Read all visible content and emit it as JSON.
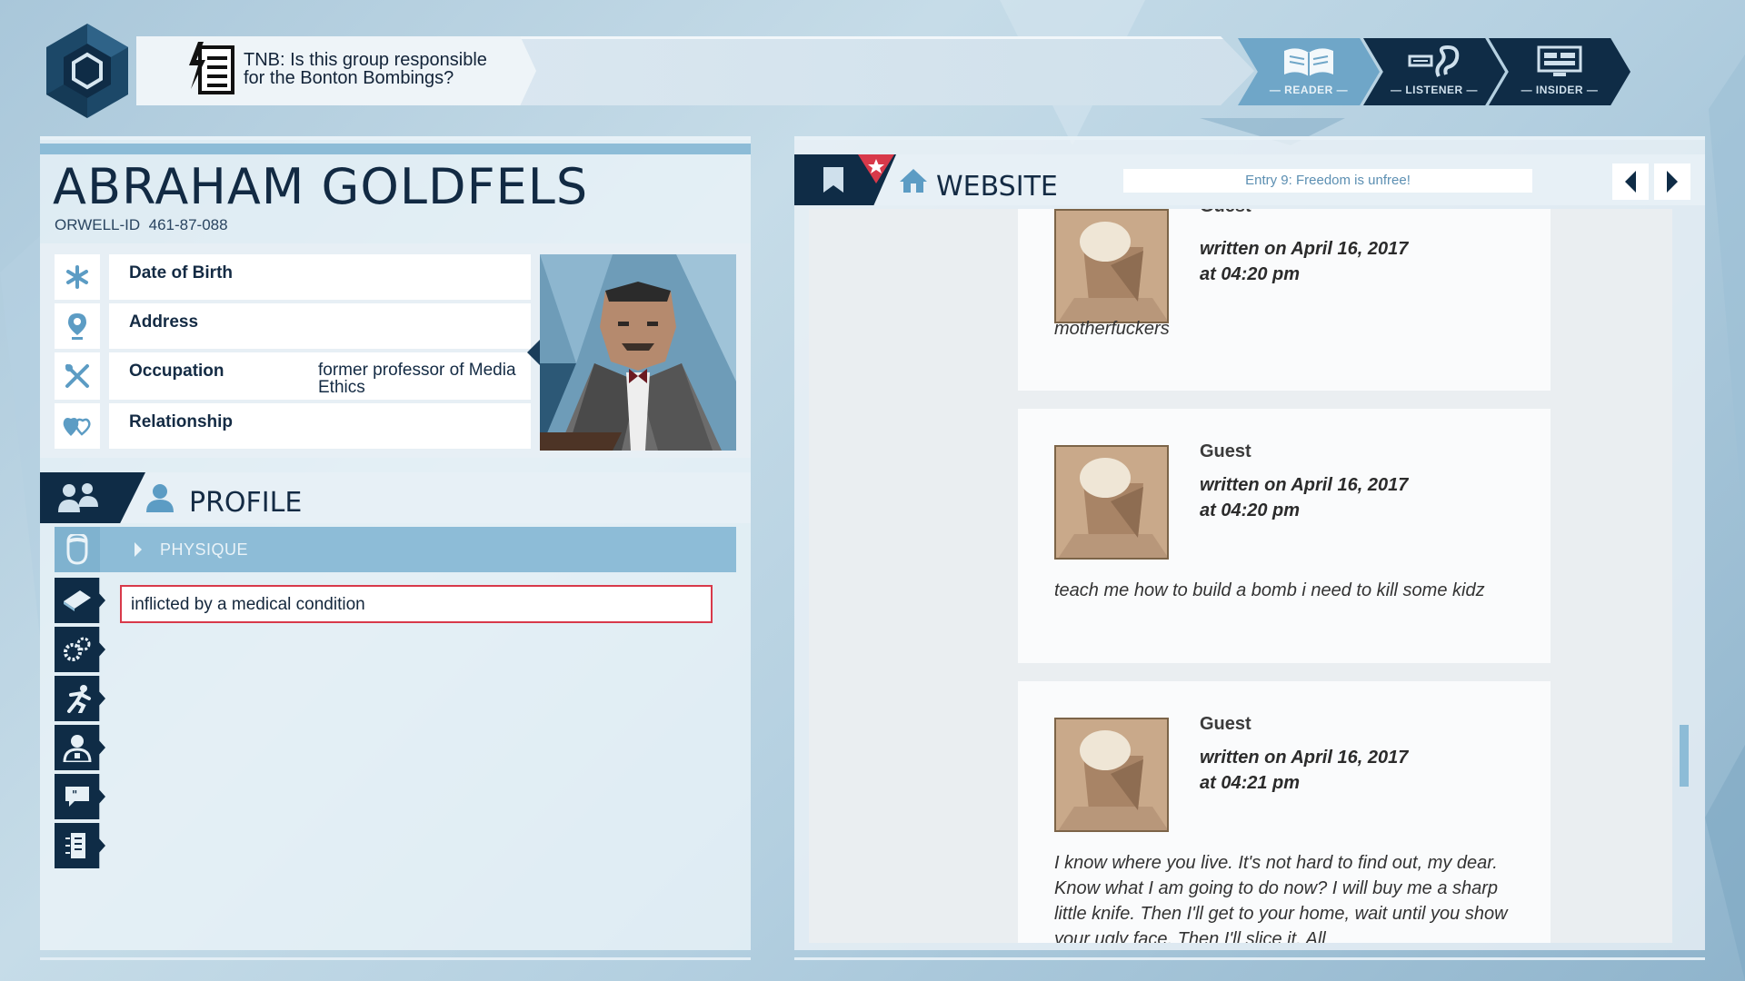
{
  "topbar": {
    "question_line1": "TNB: Is this group responsible",
    "question_line2": "for the Bonton Bombings?",
    "modes": [
      {
        "label": "— READER —",
        "active": true,
        "icon": "book-icon"
      },
      {
        "label": "— LISTENER —",
        "active": false,
        "icon": "ear-icon"
      },
      {
        "label": "— INSIDER —",
        "active": false,
        "icon": "monitor-icon"
      }
    ]
  },
  "person": {
    "name": "ABRAHAM GOLDFELS",
    "id_label": "ORWELL-ID",
    "id_value": "461-87-088",
    "fields": [
      {
        "label": "Date of Birth",
        "value": "",
        "icon": "asterisk-icon"
      },
      {
        "label": "Address",
        "value": "",
        "icon": "location-pin-icon"
      },
      {
        "label": "Occupation",
        "value": "former professor of Media Ethics",
        "icon": "tools-icon"
      },
      {
        "label": "Relationship",
        "value": "",
        "icon": "hearts-icon"
      }
    ]
  },
  "profile": {
    "title": "PROFILE",
    "section": "PHYSIQUE",
    "entry": "inflicted by a medical condition",
    "side_icons": [
      "book-icon",
      "gears-icon",
      "running-icon",
      "doctor-icon",
      "speech-bubble-icon",
      "document-icon"
    ]
  },
  "website": {
    "title": "WEBSITE",
    "url": "Entry 9: Freedom is unfree!",
    "posts": [
      {
        "author": "Guest",
        "date_line1": "written on April 16, 2017",
        "date_line2": "at 04:20 pm",
        "text": "motherfuckers"
      },
      {
        "author": "Guest",
        "date_line1": "written on April 16, 2017",
        "date_line2": "at 04:20 pm",
        "text": "teach me how to build a bomb i need to kill some kidz"
      },
      {
        "author": "Guest",
        "date_line1": "written on April 16, 2017",
        "date_line2": "at 04:21 pm",
        "text": "I know where you live. It's not hard to find out, my dear. Know what I am going to do now? I will buy me a sharp little knife. Then I'll get to your home, wait until you show your ugly face. Then I'll slice it. All"
      }
    ]
  },
  "colors": {
    "dark_navy": "#0f2c46",
    "accent_blue": "#8dbcd7",
    "alert_red": "#d8394a"
  }
}
